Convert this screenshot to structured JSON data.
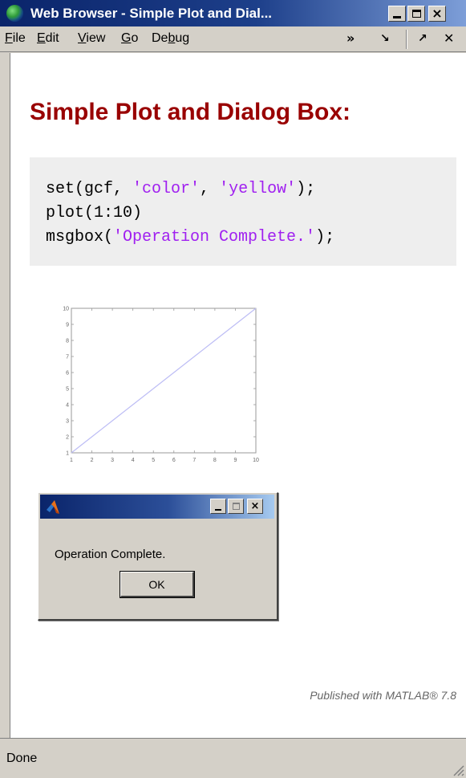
{
  "window": {
    "title": "Web Browser - Simple Plot and Dial...",
    "controls": {
      "minimize": "minimize",
      "maximize": "maximize",
      "close": "close"
    }
  },
  "menu": {
    "items": [
      {
        "label": "File",
        "mnemonic": "F",
        "rest": "ile"
      },
      {
        "label": "Edit",
        "mnemonic": "E",
        "rest": "dit"
      },
      {
        "label": "View",
        "mnemonic": "V",
        "rest": "iew"
      },
      {
        "label": "Go",
        "mnemonic": "G",
        "rest": "o"
      },
      {
        "label": "Debug",
        "pre": "De",
        "mnemonic": "b",
        "rest": "ug"
      }
    ],
    "toolbar": {
      "more": "»",
      "dock": "↘",
      "undock": "↗",
      "close": "✕"
    }
  },
  "page": {
    "title": "Simple Plot and Dialog Box:",
    "code": {
      "line1_a": "set(gcf, ",
      "line1_s1": "'color'",
      "line1_b": ", ",
      "line1_s2": "'yellow'",
      "line1_c": ");",
      "line2": "plot(1:10)",
      "line3_a": "msgbox(",
      "line3_s": "'Operation Complete.'",
      "line3_b": ");"
    },
    "published": "Published with MATLAB® 7.8"
  },
  "chart_data": {
    "type": "line",
    "x": [
      1,
      2,
      3,
      4,
      5,
      6,
      7,
      8,
      9,
      10
    ],
    "series": [
      {
        "values": [
          1,
          2,
          3,
          4,
          5,
          6,
          7,
          8,
          9,
          10
        ],
        "color": "#bdbdf5"
      }
    ],
    "xticks": [
      "1",
      "2",
      "3",
      "4",
      "5",
      "6",
      "7",
      "8",
      "9",
      "10"
    ],
    "yticks": [
      "1",
      "2",
      "3",
      "4",
      "5",
      "6",
      "7",
      "8",
      "9",
      "10"
    ],
    "xlim": [
      1,
      10
    ],
    "ylim": [
      1,
      10
    ],
    "grid": false,
    "title": "",
    "xlabel": "",
    "ylabel": ""
  },
  "dialog": {
    "message": "Operation Complete.",
    "ok_label": "OK"
  },
  "status": {
    "text": "Done"
  },
  "colors": {
    "title_red": "#990000",
    "string_purple": "#a020f0",
    "titlebar_blue": "#0a246a",
    "chrome": "#d4d0c8"
  }
}
